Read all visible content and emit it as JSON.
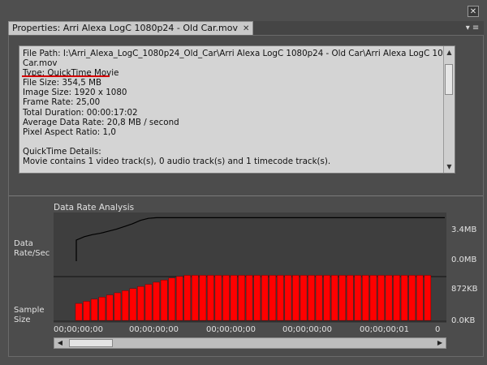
{
  "window": {
    "close_glyph": "✕"
  },
  "tab": {
    "title": "Properties: Arri Alexa LogC 1080p24 - Old Car.mov",
    "close_glyph": "✕",
    "menu_glyph": "▾ ≡"
  },
  "properties": {
    "lines": [
      "File Path: I:\\Arri_Alexa_LogC_1080p24_Old_Car\\Arri Alexa LogC 1080p24 - Old Car\\Arri Alexa LogC 1080p24 - Old",
      "Car.mov",
      "Type: QuickTime Movie",
      "File Size: 354,5 MB",
      "Image Size: 1920 x 1080",
      "Frame Rate: 25,00",
      "Total Duration: 00:00:17:02",
      "Average Data Rate: 20,8 MB / second",
      "Pixel Aspect Ratio: 1,0",
      "",
      "QuickTime Details:",
      "Movie contains 1 video track(s), 0 audio track(s) and 1 timecode track(s)."
    ],
    "highlight_color": "#d40000"
  },
  "analysis": {
    "title": "Data Rate Analysis",
    "data_rate_label_1": "Data",
    "data_rate_label_2": "Rate/Sec",
    "sample_label_1": "Sample",
    "sample_label_2": "Size",
    "data_rate_max": "3.4MB",
    "data_rate_min": "0.0MB",
    "sample_max": "872KB",
    "sample_min": "0.0KB",
    "time_ticks": [
      "00;00;00;00",
      "00;00;00;00",
      "00;00;00;00",
      "00;00;00;00",
      "00;00;00;01",
      "0"
    ]
  },
  "chart_data": [
    {
      "type": "line",
      "title": "Data Rate Analysis",
      "ylabel": "Data Rate/Sec",
      "ylim": [
        0,
        3.4
      ],
      "y_unit": "MB",
      "x": [
        0,
        0,
        1,
        2,
        3,
        4,
        5,
        6,
        7,
        8,
        9,
        10,
        11,
        12,
        13,
        14,
        15,
        16,
        17,
        18,
        19,
        20,
        21,
        22,
        23,
        24,
        25,
        26,
        27,
        28,
        29,
        30,
        31,
        32,
        33,
        34,
        35,
        36,
        37,
        38,
        39,
        40,
        41,
        42,
        43,
        44,
        45,
        46
      ],
      "values": [
        0.0,
        1.55,
        1.8,
        1.95,
        2.05,
        2.2,
        2.35,
        2.55,
        2.75,
        3.0,
        3.15,
        3.2,
        3.2,
        3.2,
        3.2,
        3.2,
        3.2,
        3.2,
        3.2,
        3.2,
        3.2,
        3.2,
        3.2,
        3.2,
        3.2,
        3.2,
        3.2,
        3.2,
        3.2,
        3.2,
        3.2,
        3.2,
        3.2,
        3.2,
        3.2,
        3.2,
        3.2,
        3.2,
        3.2,
        3.2,
        3.2,
        3.2,
        3.2,
        3.2,
        3.2,
        3.2,
        3.2,
        3.2
      ],
      "color": "#000000"
    },
    {
      "type": "bar",
      "ylabel": "Sample Size",
      "ylim": [
        0,
        872
      ],
      "y_unit": "KB",
      "values": [
        320,
        360,
        400,
        440,
        480,
        520,
        560,
        600,
        640,
        680,
        720,
        760,
        800,
        830,
        850,
        850,
        850,
        850,
        850,
        850,
        850,
        850,
        850,
        850,
        850,
        850,
        850,
        850,
        850,
        850,
        850,
        850,
        850,
        850,
        850,
        850,
        850,
        850,
        850,
        850,
        850,
        850,
        850,
        850,
        850,
        850
      ],
      "color": "#ff0000"
    }
  ]
}
